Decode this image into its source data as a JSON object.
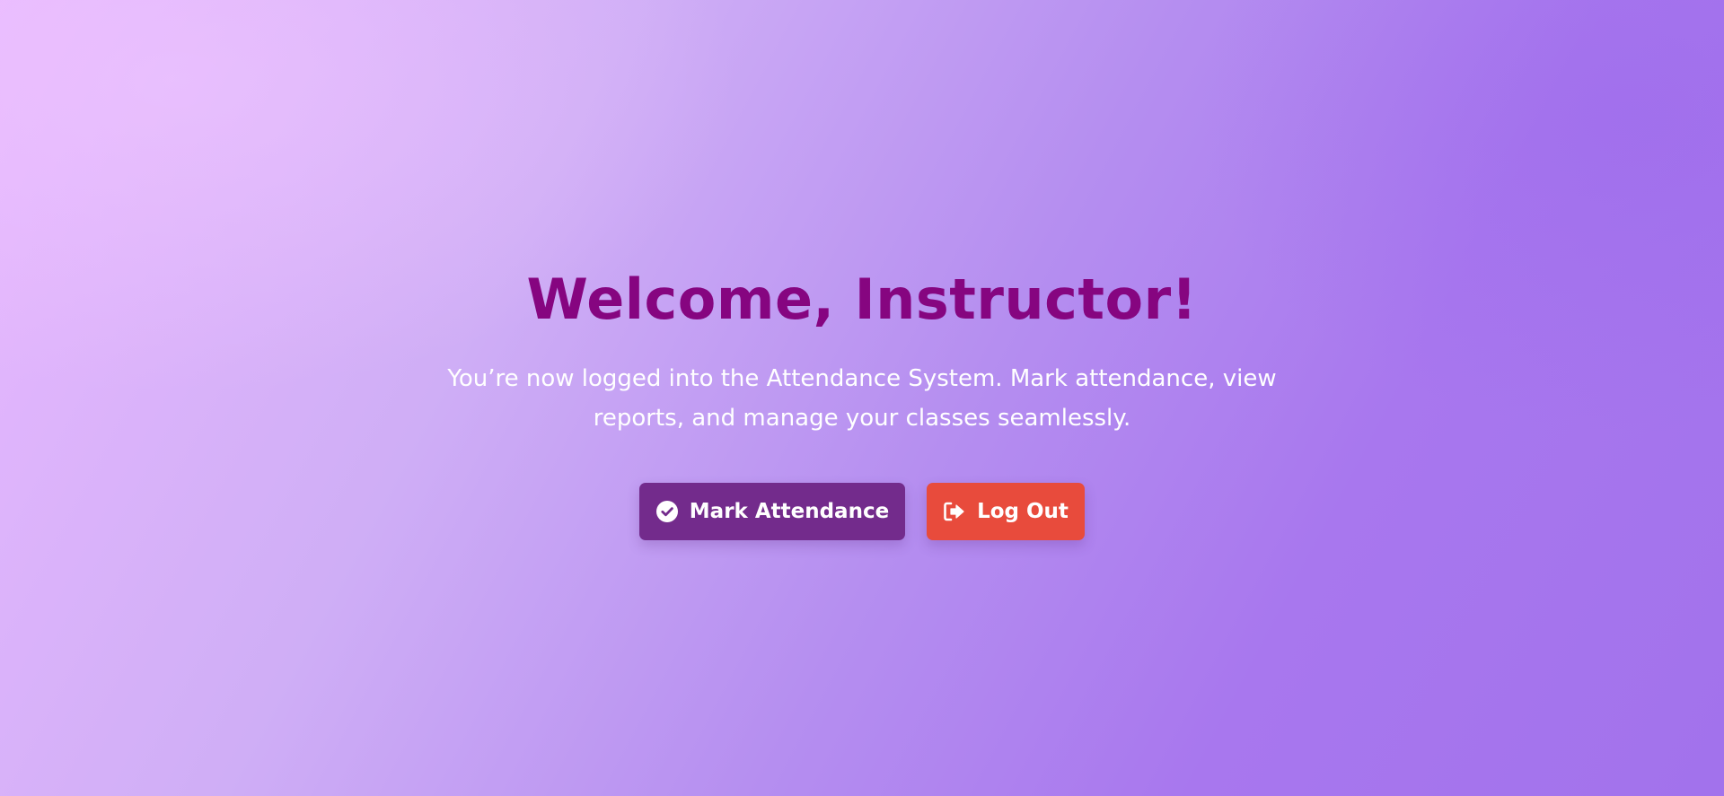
{
  "welcome": {
    "title": "Welcome, Instructor!",
    "message": "You’re now logged into the Attendance System. Mark attendance, view reports, and manage your classes seamlessly."
  },
  "actions": {
    "mark_attendance": {
      "label": "Mark Attendance",
      "icon": "check-circle-icon",
      "color": "#732b8c"
    },
    "log_out": {
      "label": "Log Out",
      "icon": "sign-out-icon",
      "color": "#e84b3c"
    }
  },
  "theme": {
    "title_color": "#860580",
    "background_start": "#e8b8ff",
    "background_end": "#a272ec"
  }
}
